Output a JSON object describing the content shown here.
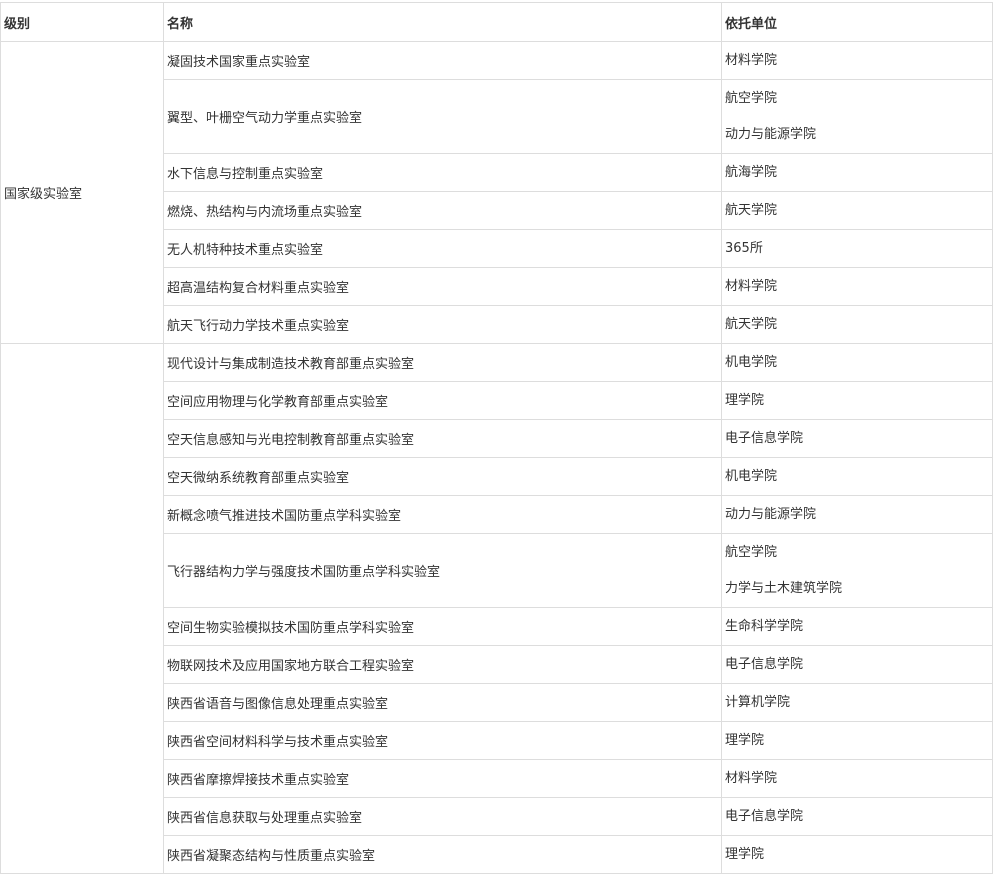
{
  "header": {
    "level": "级别",
    "name": "名称",
    "unit": "依托单位"
  },
  "groups": [
    {
      "level": "国家级实验室",
      "rows": [
        {
          "name": "凝固技术国家重点实验室",
          "units": [
            "材料学院"
          ]
        },
        {
          "name": "翼型、叶栅空气动力学重点实验室",
          "units": [
            "航空学院",
            "动力与能源学院"
          ]
        },
        {
          "name": "水下信息与控制重点实验室",
          "units": [
            "航海学院"
          ]
        },
        {
          "name": "燃烧、热结构与内流场重点实验室",
          "units": [
            "航天学院"
          ]
        },
        {
          "name": "无人机特种技术重点实验室",
          "units": [
            "365所"
          ]
        },
        {
          "name": "超高温结构复合材料重点实验室",
          "units": [
            "材料学院"
          ]
        },
        {
          "name": "航天飞行动力学技术重点实验室",
          "units": [
            "航天学院"
          ]
        }
      ]
    },
    {
      "level": "",
      "rows": [
        {
          "name": "现代设计与集成制造技术教育部重点实验室",
          "units": [
            "机电学院"
          ]
        },
        {
          "name": "空间应用物理与化学教育部重点实验室",
          "units": [
            "理学院"
          ]
        },
        {
          "name": "空天信息感知与光电控制教育部重点实验室",
          "units": [
            "电子信息学院"
          ]
        },
        {
          "name": "空天微纳系统教育部重点实验室",
          "units": [
            "机电学院"
          ]
        },
        {
          "name": "新概念喷气推进技术国防重点学科实验室",
          "units": [
            "动力与能源学院"
          ]
        },
        {
          "name": "飞行器结构力学与强度技术国防重点学科实验室",
          "units": [
            "航空学院",
            "力学与土木建筑学院"
          ]
        },
        {
          "name": "空间生物实验模拟技术国防重点学科实验室",
          "units": [
            "生命科学学院"
          ]
        },
        {
          "name": "物联网技术及应用国家地方联合工程实验室",
          "units": [
            "电子信息学院"
          ]
        },
        {
          "name": "陕西省语音与图像信息处理重点实验室",
          "units": [
            "计算机学院"
          ]
        },
        {
          "name": "陕西省空间材料科学与技术重点实验室",
          "units": [
            "理学院"
          ]
        },
        {
          "name": "陕西省摩擦焊接技术重点实验室",
          "units": [
            "材料学院"
          ]
        },
        {
          "name": "陕西省信息获取与处理重点实验室",
          "units": [
            "电子信息学院"
          ]
        },
        {
          "name": "陕西省凝聚态结构与性质重点实验室",
          "units": [
            "理学院"
          ]
        }
      ]
    }
  ]
}
